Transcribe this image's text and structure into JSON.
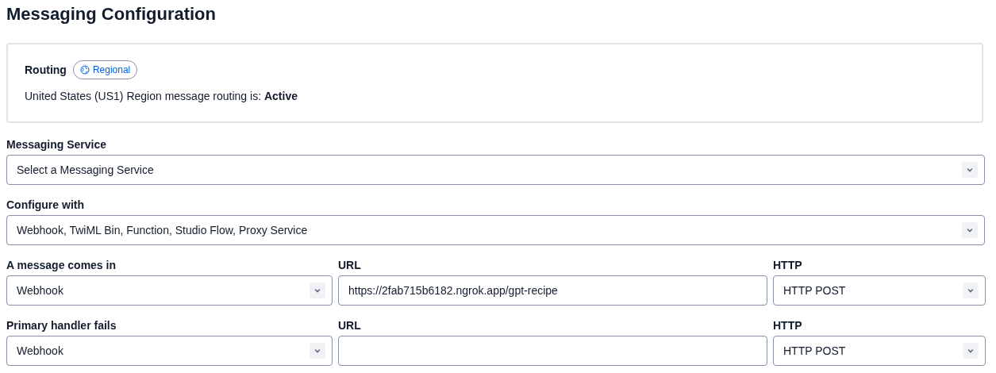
{
  "title": "Messaging Configuration",
  "routing": {
    "label": "Routing",
    "badge": "Regional",
    "status_text": "United States (US1) Region message routing is: **Active**"
  },
  "full_selects": [
    {
      "label": "Messaging Service",
      "value": "Select a Messaging Service"
    },
    {
      "label": "Configure with",
      "value": "Webhook, TwiML Bin, Function, Studio Flow, Proxy Service"
    }
  ],
  "handlers": [
    {
      "label": "A message comes in",
      "type": "Webhook",
      "url_label": "URL",
      "url": "https://2fab715b6182.ngrok.app/gpt-recipe",
      "http_label": "HTTP",
      "method": "HTTP POST"
    },
    {
      "label": "Primary handler fails",
      "type": "Webhook",
      "url_label": "URL",
      "http_label": "HTTP",
      "method": "HTTP POST"
    }
  ]
}
